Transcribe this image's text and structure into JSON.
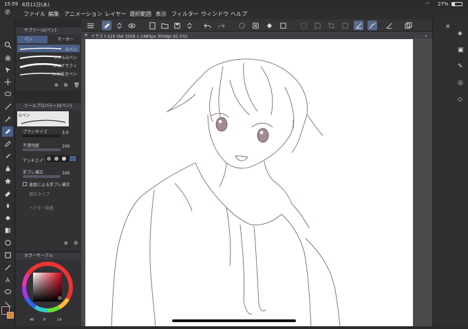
{
  "status": {
    "time": "15:59",
    "date": "8月11日(水)",
    "battery": "27%"
  },
  "menu": {
    "items": [
      "ファイル",
      "編集",
      "アニメーション",
      "レイヤー",
      "選択範囲",
      "表示",
      "フィルター",
      "ウィンドウ",
      "ヘルプ"
    ]
  },
  "document": {
    "tab_label": "イラスト229 (A4 3508 x 2480px 300dpi 65.5%)"
  },
  "subtool": {
    "title": "サブツール[ペン]",
    "tabs": [
      "ペン",
      "マーカー"
    ],
    "brushes": [
      "Gペン",
      "リアルGペン",
      "カリグラフィ",
      "入り抜きペン"
    ]
  },
  "tool_property": {
    "title": "ツールプロパティ[Gペン]",
    "preset_name": "Gペン",
    "brush_size_label": "ブラシサイズ",
    "brush_size_value": "3.0",
    "opacity_label": "不透明度",
    "opacity_value": "100",
    "antialias_label": "アンチエイリ",
    "stabilization_label": "手ブレ補正",
    "stabilization_value": "100",
    "speed_stabilization_label": "速度による手ブレ補正",
    "correction_type_label": "補正タイプ",
    "vector_snap_label": "ベクター吸着"
  },
  "color": {
    "panel_title": "カラーサークル",
    "main_color": "#3a2229",
    "sub_color": "#ffffff",
    "accent_color": "#d98a2b",
    "h_value": "48",
    "s_value": "8",
    "v_value": "14"
  },
  "colors": {
    "bg": "#2b2b2e",
    "panel": "#323235",
    "selected": "#4a5f86",
    "paper": "#ffffff"
  }
}
